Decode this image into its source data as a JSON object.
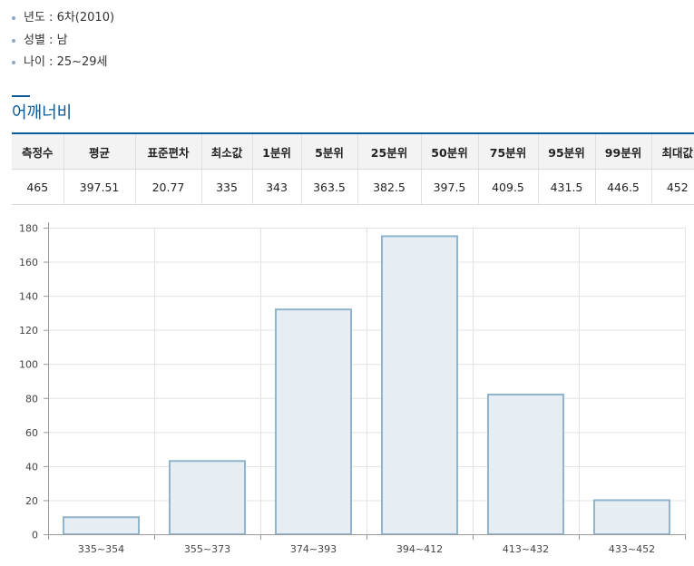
{
  "info": {
    "items": [
      {
        "label": "년도",
        "value": "6차(2010)"
      },
      {
        "label": "성별",
        "value": "남"
      },
      {
        "label": "나이",
        "value": "25~29세"
      }
    ],
    "separator": " : "
  },
  "section": {
    "title": "어깨너비"
  },
  "stats_table": {
    "headers": [
      "측정수",
      "평균",
      "표준편차",
      "최소값",
      "1분위",
      "5분위",
      "25분위",
      "50분위",
      "75분위",
      "95분위",
      "99분위",
      "최대값"
    ],
    "values": [
      "465",
      "397.51",
      "20.77",
      "335",
      "343",
      "363.5",
      "382.5",
      "397.5",
      "409.5",
      "431.5",
      "446.5",
      "452"
    ]
  },
  "colors": {
    "accent": "#0b5a99",
    "bar_fill": "#e6eef4",
    "bar_stroke": "#8fb4cc",
    "grid": "#e3e3e3"
  },
  "chart_data": {
    "type": "bar",
    "categories": [
      "335~354",
      "355~373",
      "374~393",
      "394~412",
      "413~432",
      "433~452"
    ],
    "values": [
      10,
      43,
      132,
      175,
      82,
      20
    ],
    "title": "",
    "xlabel": "",
    "ylabel": "",
    "ylim": [
      0,
      180
    ],
    "yticks": [
      0,
      20,
      40,
      60,
      80,
      100,
      120,
      140,
      160,
      180
    ],
    "grid": true,
    "legend": "none"
  }
}
